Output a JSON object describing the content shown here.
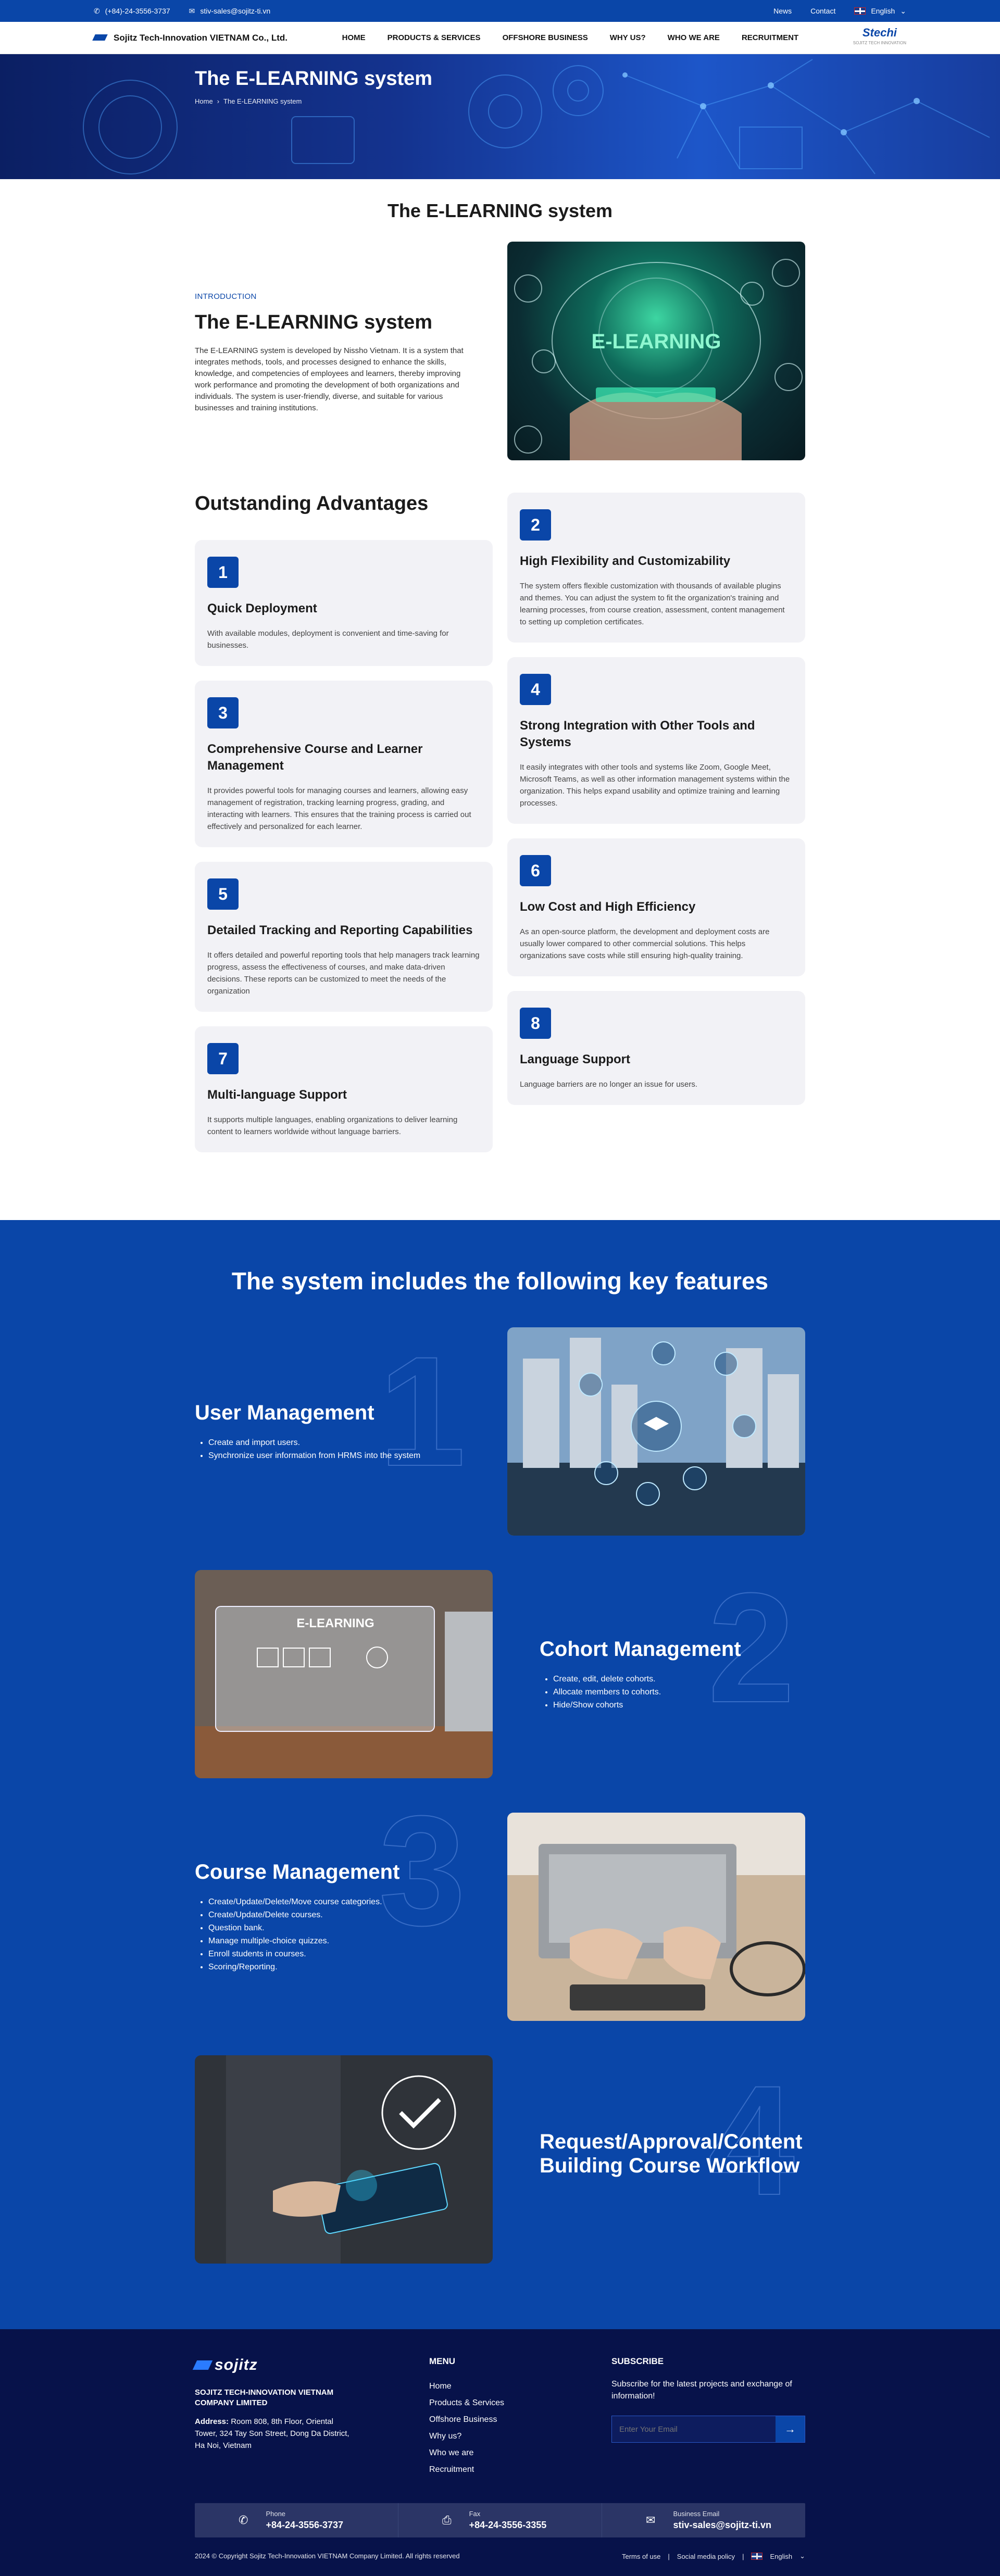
{
  "topbar": {
    "phone": "(+84)-24-3556-3737",
    "email": "stiv-sales@sojitz-ti.vn",
    "links": [
      "News",
      "Contact"
    ],
    "language": "English"
  },
  "header": {
    "brand": "Sojitz Tech-Innovation VIETNAM Co., Ltd.",
    "nav": [
      "HOME",
      "PRODUCTS & SERVICES",
      "OFFSHORE BUSINESS",
      "WHY US?",
      "WHO WE ARE",
      "RECRUITMENT"
    ],
    "logo_text": "Stechi",
    "logo_sub": "SOJITZ TECH INNOVATION"
  },
  "hero": {
    "title": "The E-LEARNING system",
    "breadcrumb_home": "Home",
    "breadcrumb_current": "The E-LEARNING system"
  },
  "page_title": "The E-LEARNING system",
  "intro": {
    "eyebrow": "INTRODUCTION",
    "title": "The E-LEARNING system",
    "body": "The E-LEARNING system is developed by Nissho Vietnam. It is a system that integrates methods, tools, and processes designed to enhance the skills, knowledge, and competencies of employees and learners, thereby improving work performance and promoting the development of both organizations and individuals. The system is user-friendly, diverse, and suitable for various businesses and training institutions.",
    "image_label": "E-LEARNING"
  },
  "advantages": {
    "title": "Outstanding Advantages",
    "items": [
      {
        "num": "1",
        "title": "Quick Deployment",
        "body": "With available modules, deployment is convenient and time-saving for businesses."
      },
      {
        "num": "2",
        "title": "High Flexibility and Customizability",
        "body": "The system offers flexible customization with thousands of available plugins and themes. You can adjust the system to fit the organization's training and learning processes, from course creation, assessment, content management to setting up completion certificates."
      },
      {
        "num": "3",
        "title": "Comprehensive Course and Learner Management",
        "body": "It provides powerful tools for managing courses and learners, allowing easy management of registration, tracking learning progress, grading, and interacting with learners. This ensures that the training process is carried out effectively and personalized for each learner."
      },
      {
        "num": "4",
        "title": "Strong Integration with Other Tools and Systems",
        "body": "It easily integrates with other tools and systems like Zoom, Google Meet, Microsoft Teams, as well as other information management systems within the organization. This helps expand usability and optimize training and learning processes."
      },
      {
        "num": "5",
        "title": "Detailed Tracking and Reporting Capabilities",
        "body": "It offers detailed and powerful reporting tools that help managers track learning progress, assess the effectiveness of courses, and make data-driven decisions. These reports can be customized to meet the needs of the organization"
      },
      {
        "num": "6",
        "title": "Low Cost and High Efficiency",
        "body": "As an open-source platform, the development and deployment costs are usually lower compared to other commercial solutions. This helps organizations save costs while still ensuring high-quality training."
      },
      {
        "num": "7",
        "title": "Multi-language Support",
        "body": "It supports multiple languages, enabling organizations to deliver learning content to learners worldwide without language barriers."
      },
      {
        "num": "8",
        "title": "Language Support",
        "body": "Language barriers are no longer an issue for users."
      }
    ]
  },
  "features": {
    "title": "The system includes the following key features",
    "items": [
      {
        "num": "1",
        "title": "User Management",
        "points": [
          "Create and import users.",
          "Synchronize user information from HRMS into the system"
        ]
      },
      {
        "num": "2",
        "title": "Cohort Management",
        "points": [
          "Create, edit, delete cohorts.",
          "Allocate members to cohorts.",
          "Hide/Show cohorts"
        ]
      },
      {
        "num": "3",
        "title": "Course Management",
        "points": [
          "Create/Update/Delete/Move course categories.",
          "Create/Update/Delete courses.",
          "Question bank.",
          "Manage multiple-choice quizzes.",
          "Enroll students in courses.",
          "Scoring/Reporting."
        ]
      },
      {
        "num": "4",
        "title": "Request/Approval/Content Building Course Workflow",
        "points": []
      }
    ],
    "image2_label": "E-LEARNING"
  },
  "footer": {
    "logo": "sojitz",
    "company": "SOJITZ TECH-INNOVATION VIETNAM COMPANY LIMITED",
    "address_label": "Address:",
    "address": "Room 808, 8th Floor, Oriental Tower, 324 Tay Son Street, Dong Da District, Ha Noi, Vietnam",
    "menu_title": "MENU",
    "menu": [
      "Home",
      "Products & Services",
      "Offshore Business",
      "Why us?",
      "Who we are",
      "Recruitment"
    ],
    "subscribe_title": "SUBSCRIBE",
    "subscribe_text": "Subscribe for the latest projects and exchange of information!",
    "email_placeholder": "Enter Your Email",
    "contacts": [
      {
        "label": "Phone",
        "value": "+84-24-3556-3737",
        "icon": "phone-icon"
      },
      {
        "label": "Fax",
        "value": "+84-24-3556-3355",
        "icon": "fax-icon"
      },
      {
        "label": "Business Email",
        "value": "stiv-sales@sojitz-ti.vn",
        "icon": "mail-icon"
      }
    ],
    "copyright": "2024 © Copyright Sojitz Tech-Innovation VIETNAM Company Limited. All rights reserved",
    "terms": "Terms of use",
    "social": "Social media policy",
    "language": "English"
  },
  "colors": {
    "primary": "#0a46a8",
    "footer": "#07124a",
    "card": "#f2f2f6"
  }
}
